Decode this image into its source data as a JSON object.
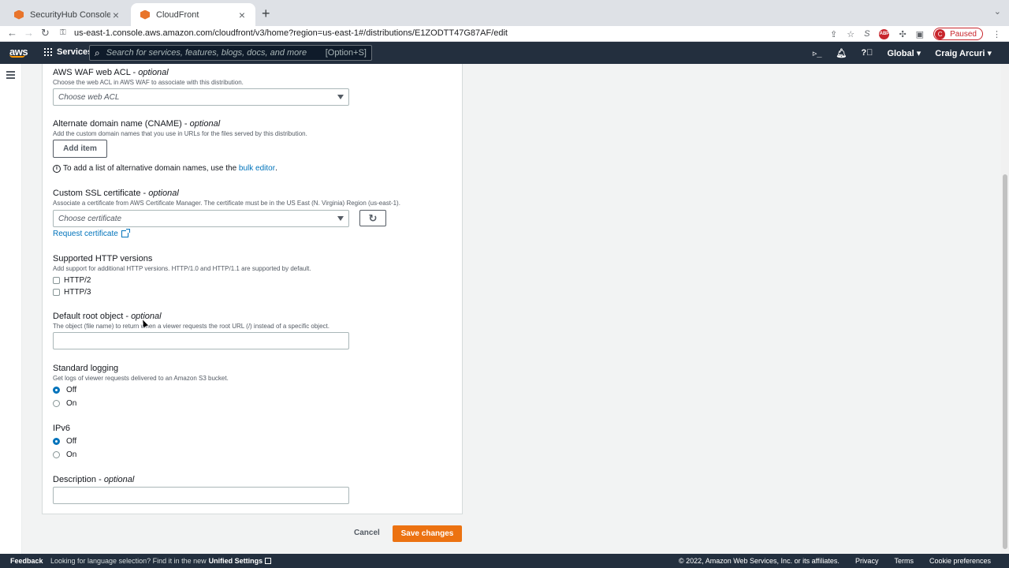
{
  "browser": {
    "tabs": [
      {
        "title": "SecurityHub Console",
        "active": false
      },
      {
        "title": "CloudFront",
        "active": true
      }
    ],
    "url": "us-east-1.console.aws.amazon.com/cloudfront/v3/home?region=us-east-1#/distributions/E1ZODTT47G87AF/edit",
    "profile_initial": "C",
    "profile_status": "Paused",
    "abp_label": "ABP"
  },
  "aws_header": {
    "logo": "aws",
    "services_label": "Services",
    "search_placeholder": "Search for services, features, blogs, docs, and more",
    "search_shortcut": "[Option+S]",
    "region": "Global",
    "user": "Craig Arcuri"
  },
  "form": {
    "waf": {
      "label": "AWS WAF web ACL",
      "optional": "optional",
      "description": "Choose the web ACL in AWS WAF to associate with this distribution.",
      "placeholder": "Choose web ACL"
    },
    "cname": {
      "label": "Alternate domain name (CNAME)",
      "optional": "optional",
      "description": "Add the custom domain names that you use in URLs for the files served by this distribution.",
      "add_button": "Add item",
      "info_text": "To add a list of alternative domain names, use the",
      "info_link": "bulk editor",
      "info_suffix": "."
    },
    "ssl": {
      "label": "Custom SSL certificate",
      "optional": "optional",
      "description": "Associate a certificate from AWS Certificate Manager. The certificate must be in the US East (N. Virginia) Region (us-east-1).",
      "placeholder": "Choose certificate",
      "request_link": "Request certificate"
    },
    "http_versions": {
      "label": "Supported HTTP versions",
      "description": "Add support for additional HTTP versions. HTTP/1.0 and HTTP/1.1 are supported by default.",
      "options": [
        {
          "label": "HTTP/2",
          "checked": false
        },
        {
          "label": "HTTP/3",
          "checked": false
        }
      ]
    },
    "root_object": {
      "label": "Default root object",
      "optional": "optional",
      "description": "The object (file name) to return when a viewer requests the root URL (/) instead of a specific object.",
      "value": ""
    },
    "logging": {
      "label": "Standard logging",
      "description": "Get logs of viewer requests delivered to an Amazon S3 bucket.",
      "options": [
        {
          "label": "Off",
          "selected": true
        },
        {
          "label": "On",
          "selected": false
        }
      ]
    },
    "ipv6": {
      "label": "IPv6",
      "options": [
        {
          "label": "Off",
          "selected": true
        },
        {
          "label": "On",
          "selected": false
        }
      ]
    },
    "description_field": {
      "label": "Description",
      "optional": "optional",
      "value": ""
    }
  },
  "actions": {
    "cancel": "Cancel",
    "save": "Save changes"
  },
  "footer": {
    "feedback": "Feedback",
    "lang_text": "Looking for language selection? Find it in the new",
    "lang_link": "Unified Settings",
    "copyright": "© 2022, Amazon Web Services, Inc. or its affiliates.",
    "links": [
      "Privacy",
      "Terms",
      "Cookie preferences"
    ]
  },
  "colors": {
    "aws_nav": "#232f3e",
    "primary_button": "#ec7211",
    "link": "#0073bb"
  }
}
